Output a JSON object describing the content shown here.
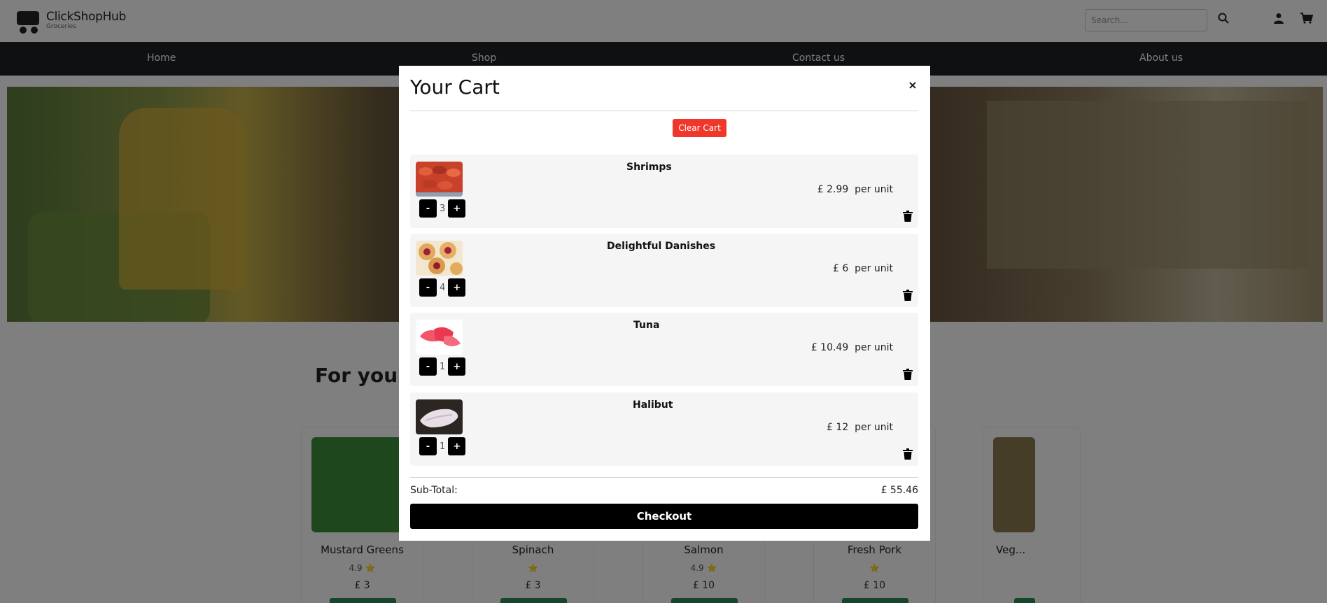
{
  "header": {
    "logo_name": "ClickShopHub",
    "logo_sub": "Groceries",
    "search_placeholder": "Search..."
  },
  "nav": {
    "items": [
      "Home",
      "Shop",
      "Contact us",
      "About us"
    ]
  },
  "main": {
    "section_title": "For you",
    "products": [
      {
        "name": "Mustard Greens",
        "rating": "4.9 ⭐",
        "price": "£ 3"
      },
      {
        "name": "Spinach",
        "rating": "⭐",
        "price": "£ 3"
      },
      {
        "name": "Salmon",
        "rating": "4.9 ⭐",
        "price": "£ 10"
      },
      {
        "name": "Fresh Pork",
        "rating": "⭐",
        "price": "£ 10"
      },
      {
        "name": "Veg...",
        "rating": "",
        "price": ""
      }
    ]
  },
  "cart": {
    "title": "Your Cart",
    "close": "×",
    "clear_label": "Clear Cart",
    "items": [
      {
        "name": "Shrimps",
        "qty": "3",
        "price": "£ 2.99",
        "unit": "per unit"
      },
      {
        "name": "Delightful Danishes",
        "qty": "4",
        "price": "£ 6",
        "unit": "per unit"
      },
      {
        "name": "Tuna",
        "qty": "1",
        "price": "£ 10.49",
        "unit": "per unit"
      },
      {
        "name": "Halibut",
        "qty": "1",
        "price": "£ 12",
        "unit": "per unit"
      }
    ],
    "minus": "-",
    "plus": "+",
    "subtotal_label": "Sub-Total:",
    "subtotal_value": "£ 55.46",
    "checkout_label": "Checkout"
  },
  "colors": {
    "clear_button": "#f0372b",
    "checkout_button": "#000000",
    "navbar": "#1e2124",
    "item_background": "#f5f5f5"
  },
  "icons": [
    "logo-cart-icon",
    "search-icon",
    "user-icon",
    "cart-icon",
    "close-icon",
    "trash-icon"
  ]
}
